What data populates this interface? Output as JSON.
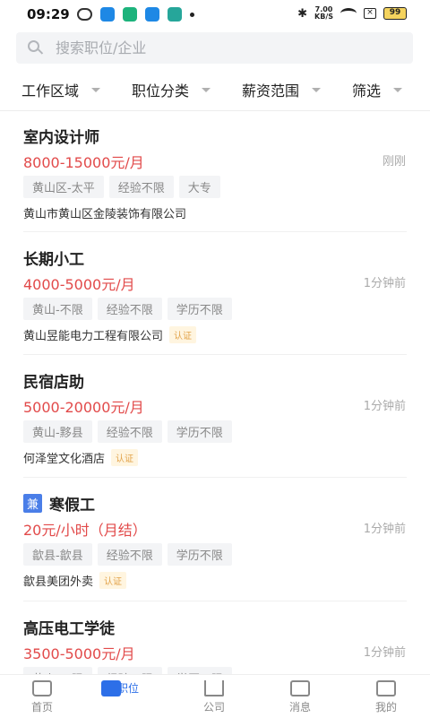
{
  "status_bar": {
    "time": "09:29",
    "net_speed_top": "7.00",
    "net_speed_bottom": "KB/S",
    "battery": "99"
  },
  "search": {
    "placeholder": "搜索职位/企业"
  },
  "filters": [
    {
      "label": "工作区域"
    },
    {
      "label": "职位分类"
    },
    {
      "label": "薪资范围"
    },
    {
      "label": "筛选"
    }
  ],
  "jobs": [
    {
      "title": "室内设计师",
      "part_time_badge": "",
      "salary": "8000-15000元/月",
      "time": "刚刚",
      "tags": [
        "黄山区-太平",
        "经验不限",
        "大专"
      ],
      "company": "黄山市黄山区金陵装饰有限公司",
      "cert": ""
    },
    {
      "title": "长期小工",
      "part_time_badge": "",
      "salary": "4000-5000元/月",
      "time": "1分钟前",
      "tags": [
        "黄山-不限",
        "经验不限",
        "学历不限"
      ],
      "company": "黄山昱能电力工程有限公司",
      "cert": "认证"
    },
    {
      "title": "民宿店助",
      "part_time_badge": "",
      "salary": "5000-20000元/月",
      "time": "1分钟前",
      "tags": [
        "黄山-黟县",
        "经验不限",
        "学历不限"
      ],
      "company": "何泽堂文化酒店",
      "cert": "认证"
    },
    {
      "title": "寒假工",
      "part_time_badge": "兼",
      "salary": "20元/小时（月结）",
      "time": "1分钟前",
      "tags": [
        "歙县-歙县",
        "经验不限",
        "学历不限"
      ],
      "company": "歙县美团外卖",
      "cert": "认证"
    },
    {
      "title": "高压电工学徒",
      "part_time_badge": "",
      "salary": "3500-5000元/月",
      "time": "1分钟前",
      "tags": [
        "黄山-不限",
        "经验不限",
        "学历不限"
      ],
      "company": "",
      "cert": ""
    }
  ],
  "bottom_nav": [
    {
      "label": "首页",
      "icon": "home-icon"
    },
    {
      "label": "职位",
      "icon": "briefcase-icon",
      "active": true
    },
    {
      "label": "公司",
      "icon": "building-icon"
    },
    {
      "label": "消息",
      "icon": "message-icon"
    },
    {
      "label": "我的",
      "icon": "profile-icon"
    }
  ],
  "colors": {
    "accent": "#2d6fe8",
    "salary": "#e24a4a",
    "part_time_badge": "#4a7ee8",
    "cert_text": "#e2a34a"
  }
}
